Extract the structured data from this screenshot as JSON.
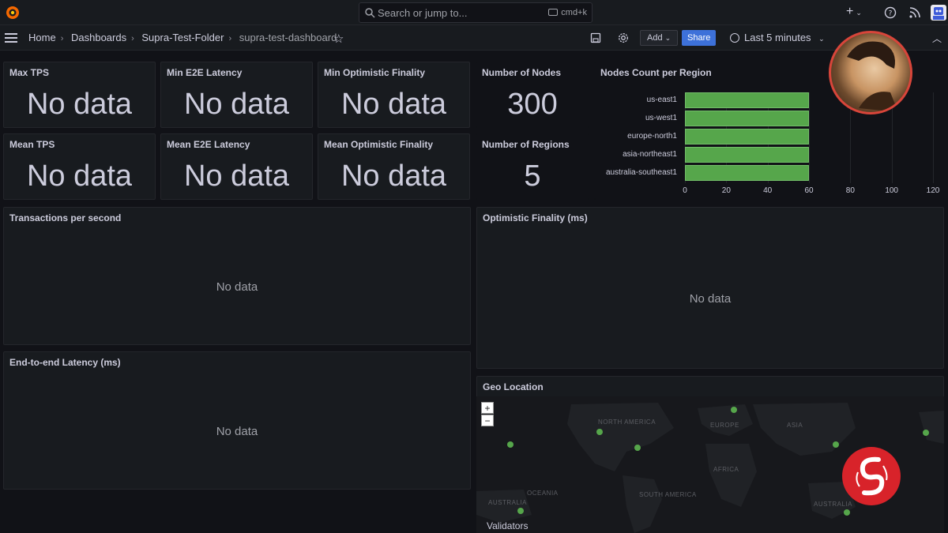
{
  "topbar": {
    "search_placeholder": "Search or jump to...",
    "shortcut": "cmd+k"
  },
  "breadcrumb": {
    "items": [
      "Home",
      "Dashboards",
      "Supra-Test-Folder"
    ],
    "current": "supra-test-dashboard"
  },
  "toolbar": {
    "add_label": "Add",
    "share_label": "Share",
    "time_range": "Last 5 minutes"
  },
  "stats": {
    "max_tps": {
      "title": "Max TPS",
      "value": "No data"
    },
    "min_e2e": {
      "title": "Min E2E Latency",
      "value": "No data"
    },
    "min_opt": {
      "title": "Min Optimistic Finality",
      "value": "No data"
    },
    "mean_tps": {
      "title": "Mean TPS",
      "value": "No data"
    },
    "mean_e2e": {
      "title": "Mean E2E Latency",
      "value": "No data"
    },
    "mean_opt": {
      "title": "Mean Optimistic Finality",
      "value": "No data"
    },
    "nodes": {
      "title": "Number of Nodes",
      "value": "300"
    },
    "regions": {
      "title": "Number of Regions",
      "value": "5"
    }
  },
  "panels": {
    "tps": {
      "title": "Transactions per second",
      "empty": "No data"
    },
    "optimistic": {
      "title": "Optimistic Finality (ms)",
      "empty": "No data"
    },
    "latency": {
      "title": "End-to-end Latency (ms)",
      "empty": "No data"
    },
    "geo": {
      "title": "Geo Location",
      "legend": "Validators",
      "zoom_in": "+",
      "zoom_out": "−"
    }
  },
  "map_labels": [
    "NORTH AMERICA",
    "EUROPE",
    "ASIA",
    "AFRICA",
    "SOUTH AMERICA",
    "AUSTRALIA",
    "OCEANIA",
    "AUSTRALIA"
  ],
  "colors": {
    "bar": "#56a64b",
    "accent": "#3d71d9",
    "background": "#111217",
    "panel": "#181b1f"
  },
  "chart_data": {
    "type": "bar",
    "orientation": "horizontal",
    "title": "Nodes Count per Region",
    "categories": [
      "us-east1",
      "us-west1",
      "europe-north1",
      "asia-northeast1",
      "australia-southeast1"
    ],
    "values": [
      60,
      60,
      60,
      60,
      60
    ],
    "xlim": [
      0,
      120
    ],
    "xticks": [
      "0",
      "20",
      "40",
      "60",
      "80",
      "100",
      "120"
    ]
  }
}
